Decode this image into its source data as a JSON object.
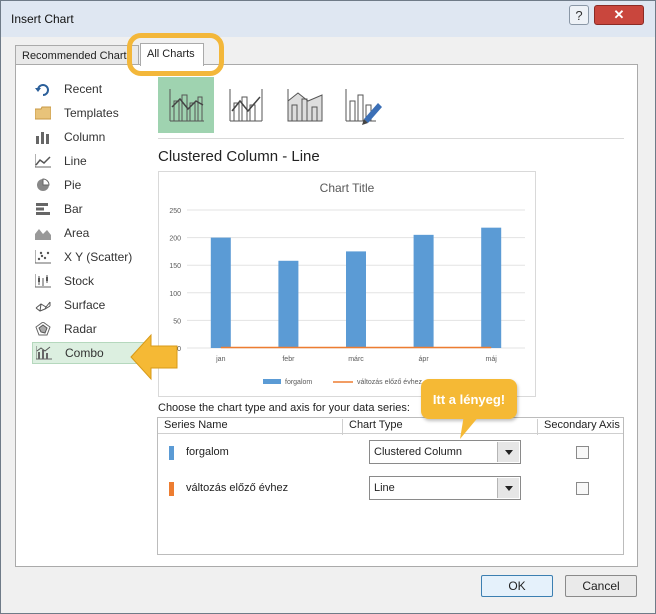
{
  "window": {
    "title": "Insert Chart",
    "help_label": "?",
    "close_label": "✕"
  },
  "tabs": {
    "recommended": "Recommended Charts",
    "all": "All Charts"
  },
  "categories": [
    {
      "label": "Recent",
      "icon": "recent-icon"
    },
    {
      "label": "Templates",
      "icon": "folder-icon"
    },
    {
      "label": "Column",
      "icon": "column-chart-icon"
    },
    {
      "label": "Line",
      "icon": "line-chart-icon"
    },
    {
      "label": "Pie",
      "icon": "pie-chart-icon"
    },
    {
      "label": "Bar",
      "icon": "bar-chart-icon"
    },
    {
      "label": "Area",
      "icon": "area-chart-icon"
    },
    {
      "label": "X Y (Scatter)",
      "icon": "scatter-chart-icon"
    },
    {
      "label": "Stock",
      "icon": "stock-chart-icon"
    },
    {
      "label": "Surface",
      "icon": "surface-chart-icon"
    },
    {
      "label": "Radar",
      "icon": "radar-chart-icon"
    },
    {
      "label": "Combo",
      "icon": "combo-chart-icon",
      "selected": true
    }
  ],
  "subtype_title": "Clustered Column - Line",
  "chart_data": {
    "type": "bar",
    "title": "Chart Title",
    "categories": [
      "jan",
      "febr",
      "márc",
      "ápr",
      "máj"
    ],
    "series": [
      {
        "name": "forgalom",
        "values": [
          200,
          158,
          175,
          205,
          218
        ],
        "color": "#5b9bd5"
      },
      {
        "name": "változás előző évhez",
        "values": [
          0,
          0,
          0,
          0,
          0
        ],
        "color": "#ed7d31"
      }
    ],
    "yticks": [
      "0",
      "50",
      "100",
      "150",
      "200",
      "250"
    ],
    "ylim": [
      0,
      250
    ],
    "legend": "bottom"
  },
  "series_section": {
    "heading": "Choose the chart type and axis for your data series:",
    "col_name": "Series Name",
    "col_type": "Chart Type",
    "col_axis": "Secondary Axis",
    "rows": [
      {
        "name": "forgalom",
        "type": "Clustered Column",
        "color": "#5b9bd5"
      },
      {
        "name": "változás előző évhez",
        "type": "Line",
        "color": "#ed7d31"
      }
    ]
  },
  "callout": "Itt a lényeg!",
  "buttons": {
    "ok": "OK",
    "cancel": "Cancel"
  }
}
